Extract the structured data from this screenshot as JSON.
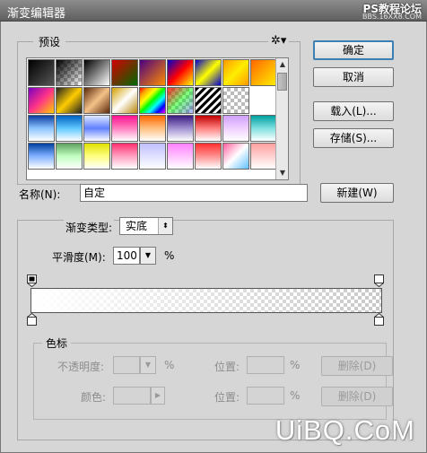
{
  "window": {
    "title": "渐变编辑器"
  },
  "watermark": {
    "logo": "PS教程论坛",
    "sub": "BBS.16XX8.COM",
    "bottom": "UiBQ.CoM"
  },
  "presets": {
    "label": "预设",
    "gear_icon": "gear-icon"
  },
  "buttons": {
    "ok": "确定",
    "cancel": "取消",
    "load": "载入(L)...",
    "save": "存储(S)...",
    "new": "新建(W)"
  },
  "name": {
    "label": "名称(N):",
    "value": "自定"
  },
  "gradient": {
    "type_label": "渐变类型:",
    "type_value": "实底",
    "smoothness_label": "平滑度(M):",
    "smoothness_value": "100",
    "smoothness_unit": "%"
  },
  "color_stops": {
    "label": "色标",
    "opacity_label": "不透明度:",
    "opacity_unit": "%",
    "color_label": "颜色:",
    "location_label": "位置:",
    "location_unit": "%",
    "delete_label": "删除(D)"
  }
}
